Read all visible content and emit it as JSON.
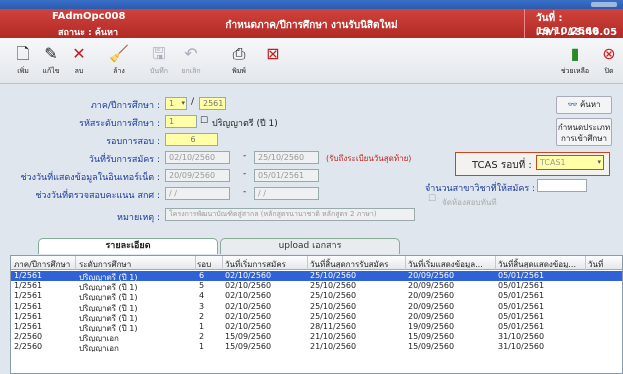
{
  "header": {
    "code": "FAdmOpc008",
    "status": "สถานะ : ค้นหา",
    "title": "กำหนดภาค/ปีการศึกษา งานรับนิสิตใหม่",
    "date": "วันที่ : 19/10/2560",
    "time": "เวลา :   13.46.05"
  },
  "toolbar": {
    "add": "เพิ่ม",
    "edit": "แก้ไข",
    "delete": "ลบ",
    "clear": "ล้าง",
    "save": "บันทึก",
    "cancel": "ยกเลิก",
    "print": "พิมพ์",
    "help": "ช่วยเหลือ",
    "close": "ปิด"
  },
  "form": {
    "term_label": "ภาค/ปีการศึกษา :",
    "term_value": "1",
    "year_value": "2561",
    "level_label": "รหัสระดับการศึกษา :",
    "level_value": "1",
    "level_text": "ปริญญาตรี (ปี 1)",
    "round_label": "รอบการสอบ :",
    "round_value": "6",
    "apply_label": "วันที่รับการสมัคร :",
    "apply_from": "02/10/2560",
    "apply_to": "25/10/2560",
    "apply_note": "(รับถึงระเบียนวันสุดท้าย)",
    "internet_label": "ช่วงวันที่แสดงข้อมูลในอินเทอร์เน็ต :",
    "internet_from": "20/09/2560",
    "internet_to": "05/01/2561",
    "check_label": "ช่วงวันที่ตรวจสอบคะแนน สกศ :",
    "check_from": "/ /",
    "check_to": "/ /",
    "remark_label": "หมายเหตุ :",
    "remark_value": "โครงการพัฒนาบัณฑิตสู่สากล (หลักสูตรนานาชาติ หลักสูตร 2 ภาษา)",
    "tcas_label": "TCAS รอบที่ :",
    "tcas_value": "TCAS1",
    "major_label": "จำนวนสาขาวิชาที่ให้สมัคร :",
    "major_value": "",
    "exam_checkbox": "จัดห้องสอบทันที",
    "search_button": "ค้นหา",
    "define_button_line1": "กำหนดประเภท",
    "define_button_line2": "การเข้าศึกษา"
  },
  "tabs": [
    {
      "label": "รายละเอียด"
    },
    {
      "label": "upload เอกสาร"
    }
  ],
  "grid": {
    "columns": [
      "ภาค/ปีการศึกษา",
      "ระดับการศึกษา",
      "รอบ",
      "วันที่เริ่มการสมัคร",
      "วันที่สิ้นสุดการรับสมัคร",
      "วันที่เริ่มแสดงข้อมูล...",
      "วันที่สิ้นสุดแสดงข้อมู...",
      "วันที่"
    ],
    "rows": [
      [
        "1/2561",
        "ปริญญาตรี (ปี 1)",
        "6",
        "02/10/2560",
        "25/10/2560",
        "20/09/2560",
        "05/01/2561"
      ],
      [
        "1/2561",
        "ปริญญาตรี (ปี 1)",
        "5",
        "02/10/2560",
        "25/10/2560",
        "20/09/2560",
        "05/01/2561"
      ],
      [
        "1/2561",
        "ปริญญาตรี (ปี 1)",
        "4",
        "02/10/2560",
        "25/10/2560",
        "20/09/2560",
        "05/01/2561"
      ],
      [
        "1/2561",
        "ปริญญาตรี (ปี 1)",
        "3",
        "02/10/2560",
        "25/10/2560",
        "20/09/2560",
        "05/01/2561"
      ],
      [
        "1/2561",
        "ปริญญาตรี (ปี 1)",
        "2",
        "02/10/2560",
        "25/10/2560",
        "20/09/2560",
        "05/01/2561"
      ],
      [
        "1/2561",
        "ปริญญาตรี (ปี 1)",
        "1",
        "02/10/2560",
        "28/11/2560",
        "19/09/2560",
        "05/01/2561"
      ],
      [
        "2/2560",
        "ปริญญาเอก",
        "2",
        "15/09/2560",
        "21/10/2560",
        "15/09/2560",
        "31/10/2560"
      ],
      [
        "2/2560",
        "ปริญญาเอก",
        "1",
        "15/09/2560",
        "21/10/2560",
        "15/09/2560",
        "31/10/2560"
      ]
    ]
  },
  "colors": {
    "header_red": "#c0342e",
    "selected_row": "#2f62d6",
    "label_blue": "#1a3a9a",
    "required_yellow": "#ffffa8"
  }
}
